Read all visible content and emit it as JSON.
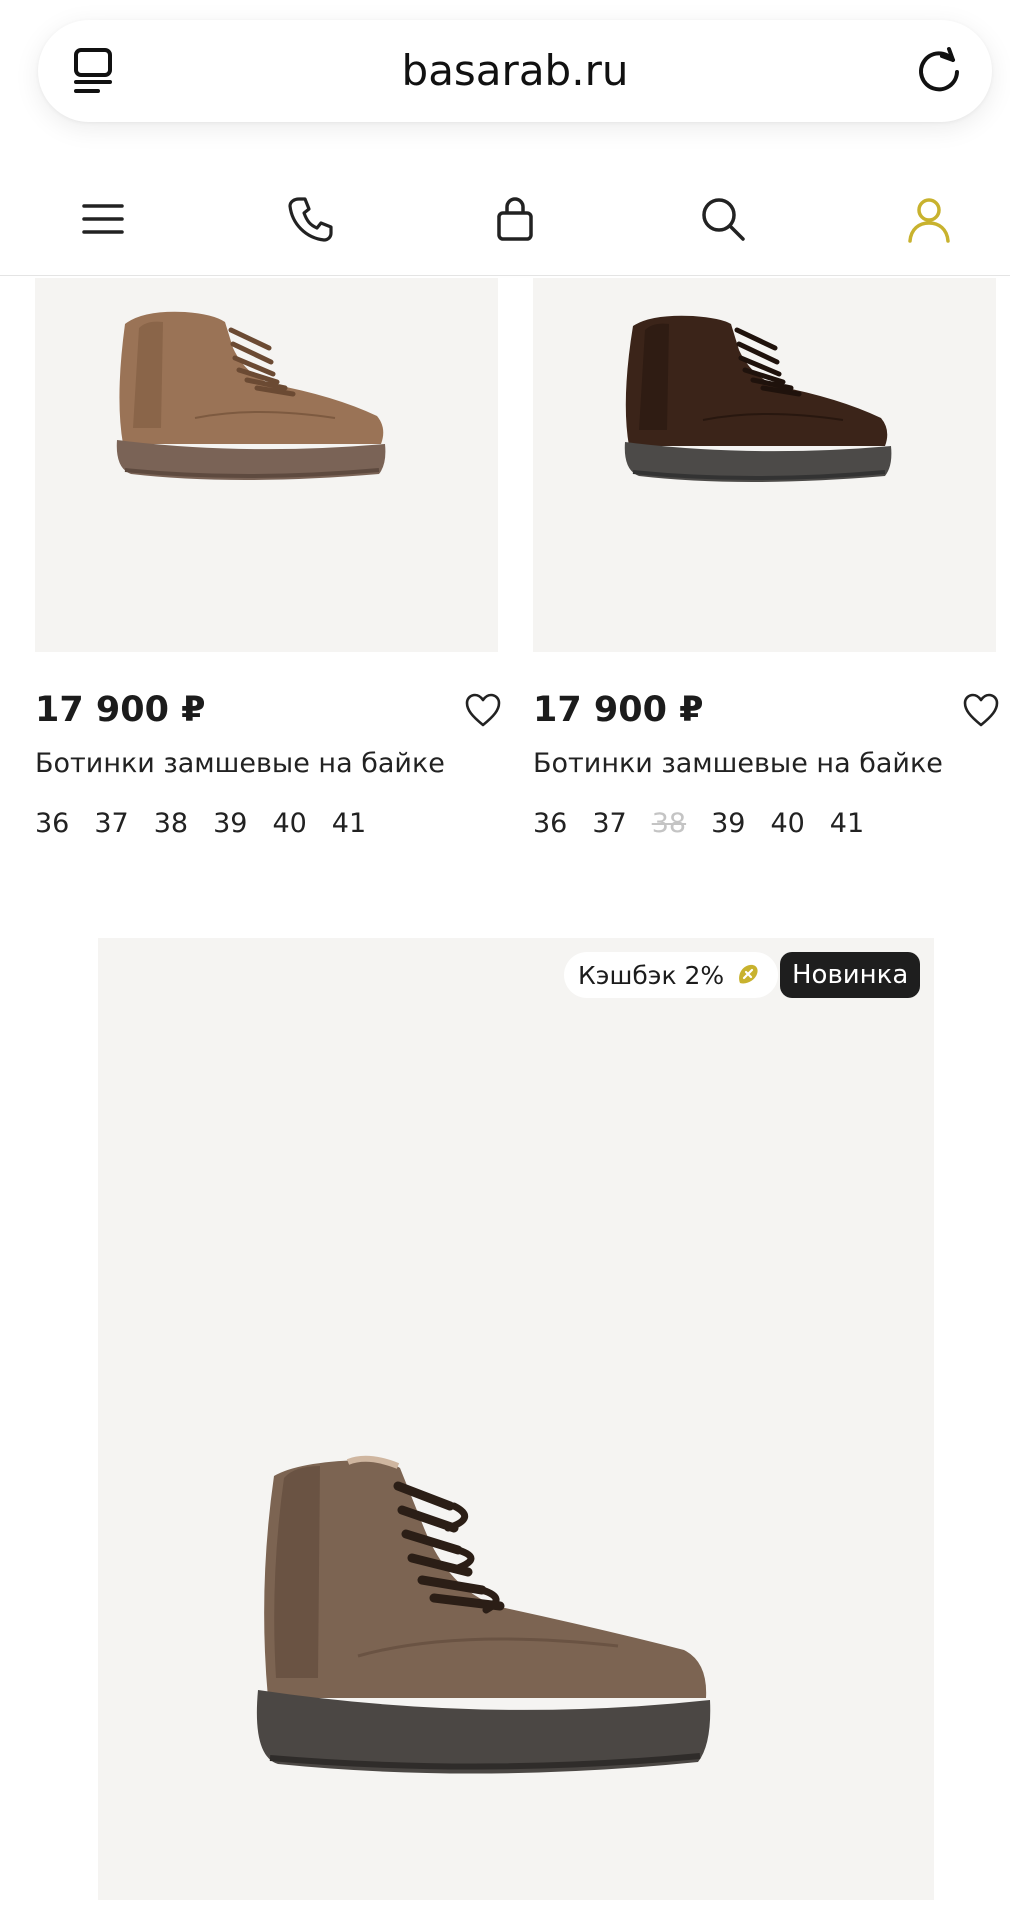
{
  "browser": {
    "domain": "basarab.ru",
    "tabs_icon": "tabs-icon",
    "reload_icon": "reload-icon"
  },
  "nav": {
    "items": [
      "menu-icon",
      "phone-icon",
      "bag-icon",
      "search-icon",
      "user-icon"
    ],
    "active_color": "#c8b22e"
  },
  "products": [
    {
      "price": "17 900 ₽",
      "name": "Ботинки замшевые на байке",
      "sizes": [
        "36",
        "37",
        "38",
        "39",
        "40",
        "41"
      ],
      "unavailable": []
    },
    {
      "price": "17 900 ₽",
      "name": "Ботинки замшевые на байке",
      "sizes": [
        "36",
        "37",
        "38",
        "39",
        "40",
        "41"
      ],
      "unavailable": [
        "38"
      ]
    }
  ],
  "featured": {
    "cashback": "Кэшбэк 2%",
    "badge": "Новинка"
  }
}
